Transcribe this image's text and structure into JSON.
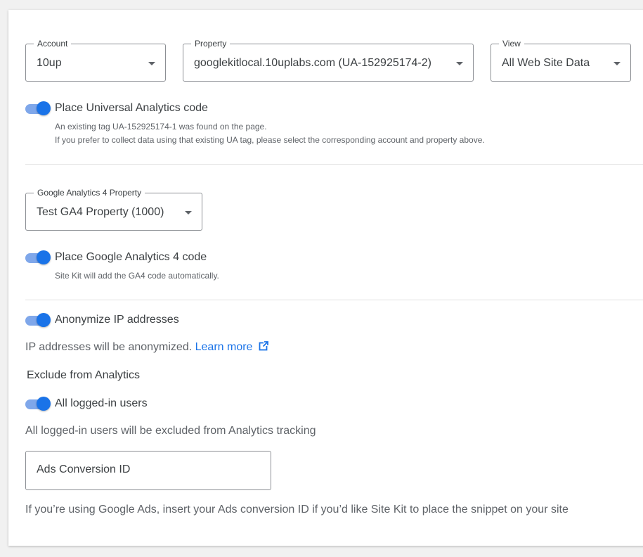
{
  "account": {
    "label": "Account",
    "value": "10up"
  },
  "property": {
    "label": "Property",
    "value": "googlekitlocal.10uplabs.com (UA-152925174-2)"
  },
  "view": {
    "label": "View",
    "value": "All Web Site Data"
  },
  "ua_toggle": {
    "label": "Place Universal Analytics code",
    "on": true,
    "help_line1": "An existing tag UA-152925174-1 was found on the page.",
    "help_line2": "If you prefer to collect data using that existing UA tag, please select the corresponding account and property above."
  },
  "ga4_property": {
    "label": "Google Analytics 4 Property",
    "value": "Test GA4 Property (1000)"
  },
  "ga4_toggle": {
    "label": "Place Google Analytics 4 code",
    "on": true,
    "help": "Site Kit will add the GA4 code automatically."
  },
  "anonymize": {
    "label": "Anonymize IP addresses",
    "on": true,
    "description": "IP addresses will be anonymized.",
    "learn_more": "Learn more",
    "learn_more_icon": "external-link-icon"
  },
  "exclude": {
    "heading": "Exclude from Analytics",
    "toggle_label": "All logged-in users",
    "on": true,
    "description": "All logged-in users will be excluded from Analytics tracking"
  },
  "ads_conversion": {
    "placeholder": "Ads Conversion ID",
    "help": "If you’re using Google Ads, insert your Ads conversion ID if you’d like Site Kit to place the snippet on your site"
  },
  "colors": {
    "accent": "#1a73e8",
    "toggle_track": "#7fa7ea",
    "link": "#1a73e8"
  }
}
